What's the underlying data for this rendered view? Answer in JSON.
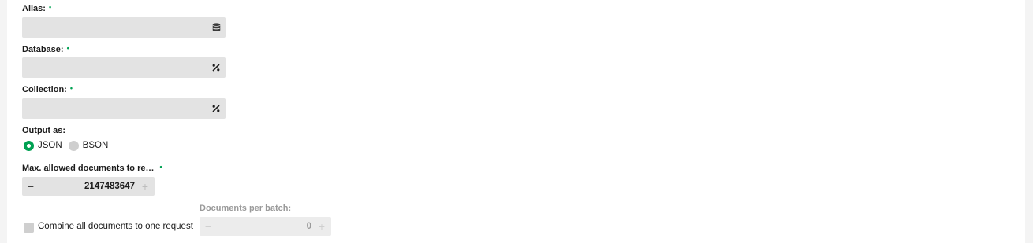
{
  "fields": {
    "alias": {
      "label": "Alias:",
      "required": "•",
      "value": "",
      "icon": "database-icon"
    },
    "database": {
      "label": "Database:",
      "required": "•",
      "value": "",
      "icon": "flow-variable-icon"
    },
    "collection": {
      "label": "Collection:",
      "required": "•",
      "value": "",
      "icon": "flow-variable-icon"
    }
  },
  "output": {
    "label": "Output as:",
    "options": [
      {
        "label": "JSON",
        "selected": true
      },
      {
        "label": "BSON",
        "selected": false
      }
    ]
  },
  "max_docs": {
    "label": "Max. allowed documents to re…",
    "required": "•",
    "minus": "−",
    "plus": "+",
    "value": "2147483647"
  },
  "batch": {
    "label": "Documents per batch:",
    "minus": "−",
    "plus": "+",
    "value": "0"
  },
  "combine": {
    "label": "Combine all documents to one request",
    "checked": false
  },
  "colors": {
    "accent": "#00a152",
    "field_bg": "#e3e3e3",
    "disabled_text": "#bdbdbd"
  }
}
